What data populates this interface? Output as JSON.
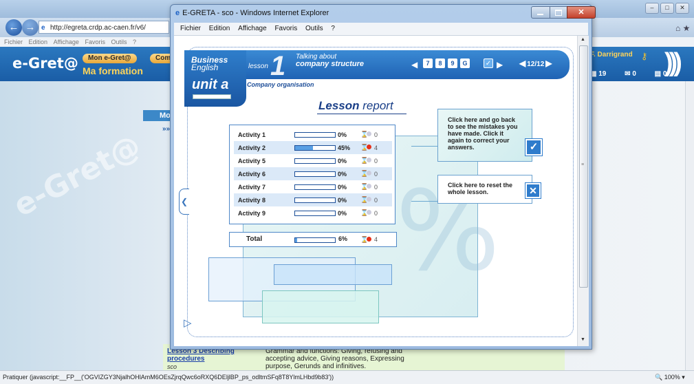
{
  "browser": {
    "address": "http://egreta.crdp.ac-caen.fr/v6/",
    "menu": [
      "Fichier",
      "Edition",
      "Affichage",
      "Favoris",
      "Outils",
      "?"
    ],
    "logo": "e-Gret@",
    "tabs": [
      "Mon e-Gret@",
      "Com"
    ],
    "section_title": "Ma formation",
    "user_name": "F. Darrigrand",
    "counts": [
      "19",
      "0",
      "0"
    ],
    "watermark": "e-Gret@",
    "mo_label": "Mo",
    "nav_arrows": "»»",
    "status_text": "Pratiquer (javascript:__FP__('OGVIZGY3NjalhOHlAmM6OEsZjrqQwc6oRXQ6DEljlBP_ps_odltmSFq8T8YlmLHbd9b83'))",
    "zoom": "100%",
    "lesson_row": {
      "link": "Lesson 3 Describing procedures",
      "sco": "sco",
      "description": "Grammar and functions: Giving, refusing and accepting advice, Giving reasons, Expressing purpose, Gerunds and infinitives."
    }
  },
  "popup": {
    "title": "E-GRETA - sco - Windows Internet Explorer",
    "close": "✕",
    "menu": [
      "Fichier",
      "Edition",
      "Affichage",
      "Favoris",
      "Outils",
      "?"
    ]
  },
  "lesson": {
    "course_line1": "Business",
    "course_line2": "English",
    "unit": "unit a",
    "lesson_word": "lesson",
    "lesson_number": "1",
    "topic_line1": "Talking about",
    "topic_line2": "company structure",
    "subtopic": "Company organisation",
    "nav_items": [
      "7",
      "8",
      "9",
      "G"
    ],
    "page_indicator": "12/12",
    "report_title_bold": "Lesson",
    "report_title_rest": " report"
  },
  "activities": [
    {
      "name": "Activity 1",
      "percent": "0%",
      "progress": 0,
      "count": "0",
      "has_errors": false
    },
    {
      "name": "Activity 2",
      "percent": "45%",
      "progress": 0.45,
      "count": "4",
      "has_errors": true
    },
    {
      "name": "Activity 5",
      "percent": "0%",
      "progress": 0,
      "count": "0",
      "has_errors": false
    },
    {
      "name": "Activity 6",
      "percent": "0%",
      "progress": 0,
      "count": "0",
      "has_errors": false
    },
    {
      "name": "Activity 7",
      "percent": "0%",
      "progress": 0,
      "count": "0",
      "has_errors": false
    },
    {
      "name": "Activity 8",
      "percent": "0%",
      "progress": 0,
      "count": "0",
      "has_errors": false
    },
    {
      "name": "Activity 9",
      "percent": "0%",
      "progress": 0,
      "count": "0",
      "has_errors": false
    }
  ],
  "total": {
    "label": "Total",
    "percent": "6%",
    "progress": 0.06,
    "count": "4"
  },
  "review": {
    "text": "Click here and go back to see the mistakes you have made. Click it again to correct your answers.",
    "icon": "check-icon"
  },
  "reset": {
    "text": "Click here to reset the whole lesson.",
    "icon": "x-icon"
  },
  "colors": {
    "accent": "#1f63b4",
    "error_dot": "#e63018",
    "progress_fill": "#5aa0e4"
  }
}
